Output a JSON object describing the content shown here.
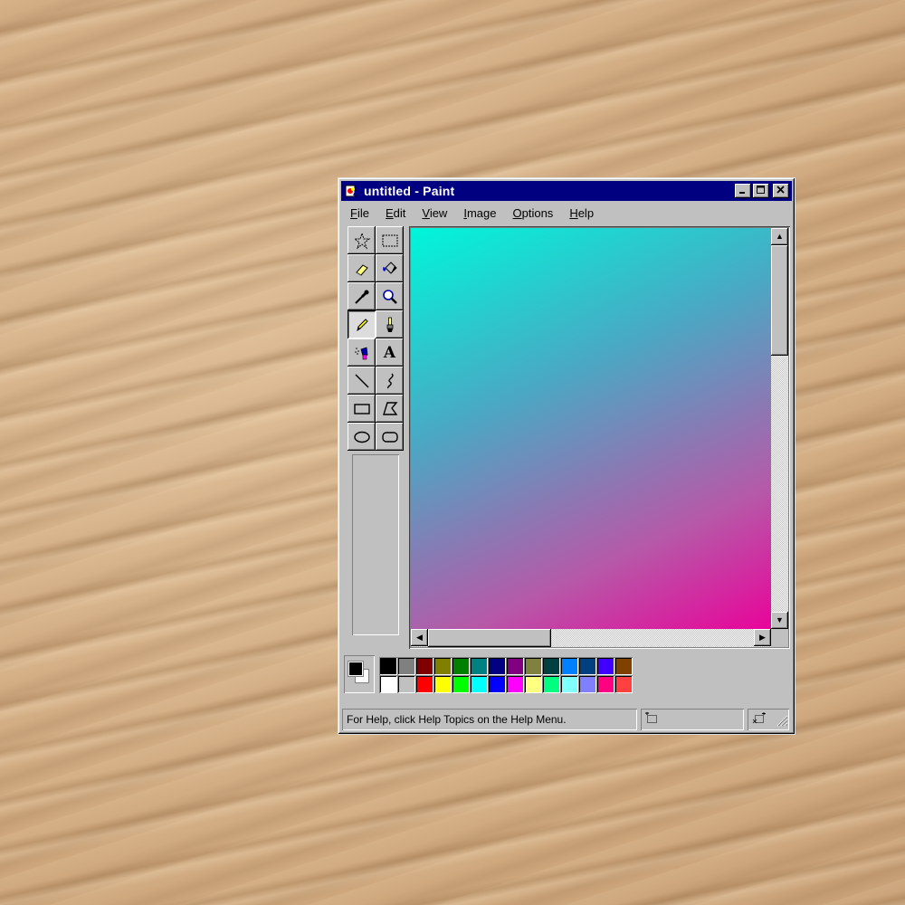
{
  "window": {
    "title": "untitled - Paint",
    "controls": {
      "minimize": "_",
      "maximize": "□",
      "close": "✕"
    }
  },
  "menu": [
    {
      "label": "File",
      "access_key": "F"
    },
    {
      "label": "Edit",
      "access_key": "E"
    },
    {
      "label": "View",
      "access_key": "V"
    },
    {
      "label": "Image",
      "access_key": "I"
    },
    {
      "label": "Options",
      "access_key": "O"
    },
    {
      "label": "Help",
      "access_key": "H"
    }
  ],
  "tools": [
    {
      "name": "free-form-select",
      "icon": "star-select-icon"
    },
    {
      "name": "select",
      "icon": "rect-select-icon"
    },
    {
      "name": "eraser",
      "icon": "eraser-icon"
    },
    {
      "name": "fill-with-color",
      "icon": "paint-bucket-icon"
    },
    {
      "name": "pick-color",
      "icon": "eyedropper-icon"
    },
    {
      "name": "magnifier",
      "icon": "magnifier-icon"
    },
    {
      "name": "pencil",
      "icon": "pencil-icon",
      "active": true
    },
    {
      "name": "brush",
      "icon": "brush-icon"
    },
    {
      "name": "airbrush",
      "icon": "airbrush-icon"
    },
    {
      "name": "text",
      "icon": "text-icon",
      "glyph": "A"
    },
    {
      "name": "line",
      "icon": "line-icon"
    },
    {
      "name": "curve",
      "icon": "curve-icon"
    },
    {
      "name": "rectangle",
      "icon": "rectangle-icon"
    },
    {
      "name": "polygon",
      "icon": "polygon-icon"
    },
    {
      "name": "ellipse",
      "icon": "ellipse-icon"
    },
    {
      "name": "rounded-rectangle",
      "icon": "rounded-rectangle-icon"
    }
  ],
  "canvas": {
    "gradient_colors": [
      "#00f6da",
      "#4aa8c4",
      "#b659a8",
      "#e8049a"
    ]
  },
  "colors": {
    "foreground": "#000000",
    "background": "#ffffff",
    "palette_row1": [
      "#000000",
      "#808080",
      "#800000",
      "#808000",
      "#008000",
      "#008080",
      "#000080",
      "#800080",
      "#808040",
      "#004040",
      "#0080ff",
      "#004080",
      "#4000ff",
      "#804000"
    ],
    "palette_row2": [
      "#ffffff",
      "#c0c0c0",
      "#ff0000",
      "#ffff00",
      "#00ff00",
      "#00ffff",
      "#0000ff",
      "#ff00ff",
      "#ffff80",
      "#00ff80",
      "#80ffff",
      "#8080ff",
      "#ff0080",
      "#ff4040"
    ]
  },
  "status": {
    "message": "For Help, click Help Topics on the Help Menu.",
    "position": "",
    "size": ""
  }
}
